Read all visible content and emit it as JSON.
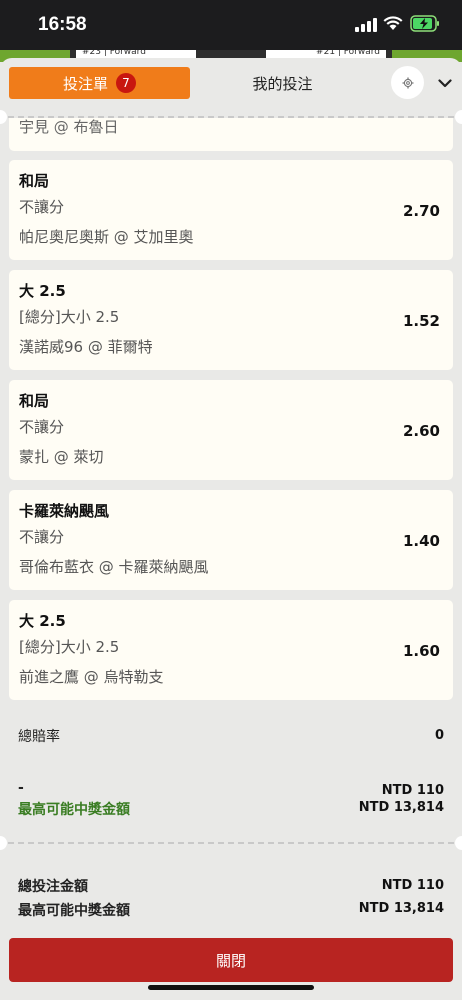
{
  "status_bar": {
    "time": "16:58"
  },
  "background_peek": {
    "left_player": "#23 | Forward",
    "right_player": "#21 | Forward"
  },
  "header": {
    "tab_bets_label": "投注單",
    "tab_bets_count": "7",
    "tab_mine_label": "我的投注",
    "settings_icon": "gear-icon",
    "collapse_icon": "chevron-down-icon"
  },
  "partial_bet": {
    "event": "宇見 @ 布魯日"
  },
  "bets": [
    {
      "selection": "和局",
      "market": "不讓分",
      "event": "帕尼奧尼奧斯 @ 艾加里奧",
      "odds": "2.70"
    },
    {
      "selection": "大 2.5",
      "market": "[總分]大小 2.5",
      "event": "漢諾威96 @ 菲爾特",
      "odds": "1.52"
    },
    {
      "selection": "和局",
      "market": "不讓分",
      "event": "蒙扎 @ 萊切",
      "odds": "2.60"
    },
    {
      "selection": "卡羅萊納颶風",
      "market": "不讓分",
      "event": "哥倫布藍衣 @ 卡羅萊納颶風",
      "odds": "1.40"
    },
    {
      "selection": "大 2.5",
      "market": "[總分]大小 2.5",
      "event": "前進之鷹 @ 烏特勒支",
      "odds": "1.60"
    }
  ],
  "summary": {
    "total_odds_label": "總賠率",
    "total_odds_value": "0",
    "stake_placeholder": "-",
    "stake_value": "NTD 110",
    "max_win_label": "最高可能中獎金額",
    "max_win_value": "NTD 13,814"
  },
  "totals": {
    "total_stake_label": "總投注金額",
    "total_stake_value": "NTD 110",
    "max_win_label": "最高可能中獎金額",
    "max_win_value": "NTD 13,814"
  },
  "close_label": "關閉",
  "colors": {
    "accent": "#f07c1a",
    "close": "#b82421",
    "win_green": "#3a7d23",
    "card_bg": "#fffdf5"
  }
}
